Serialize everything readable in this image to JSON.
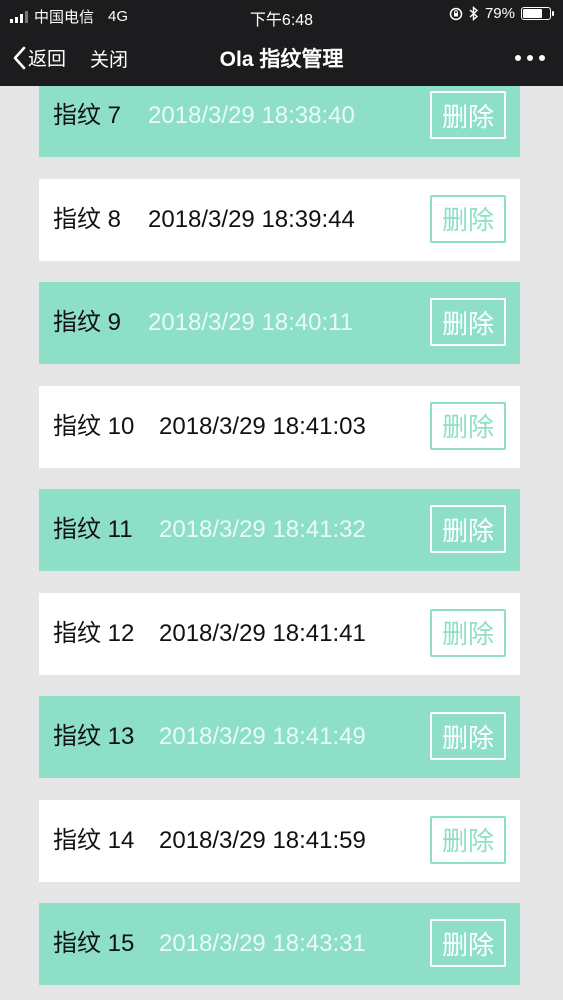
{
  "status_bar": {
    "carrier": "中国电信",
    "network": "4G",
    "time": "下午6:48",
    "battery_text": "79%",
    "battery_level": 0.79
  },
  "nav": {
    "back_label": "返回",
    "close_label": "关闭",
    "title": "Ola 指纹管理"
  },
  "fingerprints": [
    {
      "name": "指纹 7",
      "time": "2018/3/29 18:38:40",
      "delete_label": "删除",
      "style": "green"
    },
    {
      "name": "指纹 8",
      "time": "2018/3/29 18:39:44",
      "delete_label": "删除",
      "style": "white"
    },
    {
      "name": "指纹 9",
      "time": "2018/3/29 18:40:11",
      "delete_label": "删除",
      "style": "green"
    },
    {
      "name": "指纹 10",
      "time": "2018/3/29 18:41:03",
      "delete_label": "删除",
      "style": "white"
    },
    {
      "name": "指纹 11",
      "time": "2018/3/29 18:41:32",
      "delete_label": "删除",
      "style": "green"
    },
    {
      "name": "指纹 12",
      "time": "2018/3/29 18:41:41",
      "delete_label": "删除",
      "style": "white"
    },
    {
      "name": "指纹 13",
      "time": "2018/3/29 18:41:49",
      "delete_label": "删除",
      "style": "green"
    },
    {
      "name": "指纹 14",
      "time": "2018/3/29 18:41:59",
      "delete_label": "删除",
      "style": "white"
    },
    {
      "name": "指纹 15",
      "time": "2018/3/29 18:43:31",
      "delete_label": "删除",
      "style": "green"
    }
  ],
  "colors": {
    "accent": "#8ddfc8",
    "bar": "#1c1c1e",
    "background": "#e6e6e6"
  },
  "icons": [
    "signal-icon",
    "location-lock-icon",
    "bluetooth-icon",
    "battery-icon",
    "back-chevron-icon",
    "more-icon"
  ]
}
